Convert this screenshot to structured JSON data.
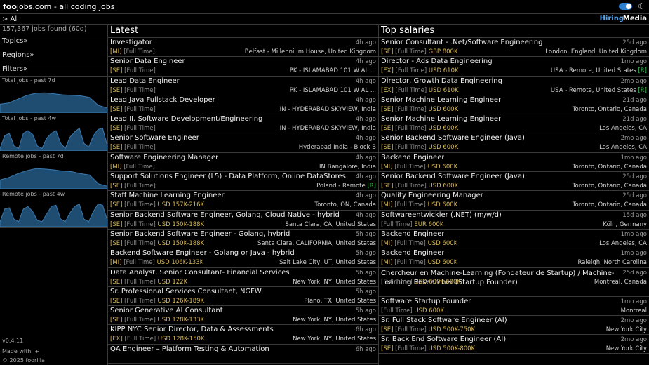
{
  "header": {
    "logo_bold": "foo",
    "logo_rest": "jobs.com - all coding jobs"
  },
  "nav": {
    "breadcrumb": "> All",
    "hiring_label": "Hiring",
    "media_label": "Media"
  },
  "sidebar": {
    "jobs_found": "157,367 jobs found (60d)",
    "menus": [
      "Topics»",
      "Regions»",
      "Filters»"
    ],
    "charts": [
      {
        "title": "Total jobs - past 7d",
        "values": [
          0.35,
          0.4,
          0.55,
          0.7,
          0.78,
          0.8,
          0.76,
          0.72,
          0.7,
          0.68,
          0.62,
          0.3,
          0.2
        ]
      },
      {
        "title": "Total jobs - past 4w",
        "values": [
          0.1,
          0.6,
          0.7,
          0.2,
          0.1,
          0.7,
          0.8,
          0.65,
          0.2,
          0.1,
          0.5,
          0.7,
          0.8,
          0.3,
          0.1,
          0.55,
          0.75,
          0.9,
          0.3,
          0.15,
          0.6,
          0.85,
          0.9,
          0.2
        ]
      },
      {
        "title": "Remote jobs - past 7d",
        "values": [
          0.35,
          0.45,
          0.6,
          0.72,
          0.8,
          0.78,
          0.75,
          0.7,
          0.68,
          0.6,
          0.55,
          0.2,
          0.1
        ]
      },
      {
        "title": "Remote jobs - past 4w",
        "values": [
          0.2,
          0.7,
          0.75,
          0.3,
          0.2,
          0.7,
          0.8,
          0.6,
          0.25,
          0.2,
          0.5,
          0.8,
          0.85,
          0.3,
          0.2,
          0.55,
          0.8,
          0.9,
          0.3,
          0.2,
          0.6,
          0.9,
          0.85,
          0.25
        ]
      }
    ],
    "version": "v0.4.11",
    "made_with": "Made with",
    "heart": "+",
    "copyright": "© 2025 foorilla"
  },
  "latest": {
    "heading": "Latest",
    "jobs": [
      {
        "title": "Investigator",
        "age": "4h ago",
        "level": "[MI]",
        "type": "[Full Time]",
        "salary": "",
        "location": "Belfast - Millennium House, United Kingdom",
        "remote": ""
      },
      {
        "title": "Senior Data Engineer",
        "age": "4h ago",
        "level": "[SE]",
        "type": "[Full Time]",
        "salary": "",
        "location": "PK - ISLAMABAD 101 W AL ...",
        "remote": ""
      },
      {
        "title": "Lead Data Engineer",
        "age": "4h ago",
        "level": "[SE]",
        "type": "[Full Time]",
        "salary": "",
        "location": "PK - ISLAMABAD 101 W AL ...",
        "remote": ""
      },
      {
        "title": "Lead Java Fullstack Developer",
        "age": "4h ago",
        "level": "[SE]",
        "type": "[Full Time]",
        "salary": "",
        "location": "IN - HYDERABAD SKYVIEW, India",
        "remote": ""
      },
      {
        "title": "Lead II, Software Development/Engineering",
        "age": "4h ago",
        "level": "[SE]",
        "type": "[Full Time]",
        "salary": "",
        "location": "IN - HYDERABAD SKYVIEW, India",
        "remote": ""
      },
      {
        "title": "Senior Software Engineer",
        "age": "4h ago",
        "level": "[SE]",
        "type": "[Full Time]",
        "salary": "",
        "location": "Hyderabad India - Block B",
        "remote": ""
      },
      {
        "title": "Software Engineering Manager",
        "age": "4h ago",
        "level": "[MI]",
        "type": "[Full Time]",
        "salary": "",
        "location": "IN Bangalore, India",
        "remote": ""
      },
      {
        "title": "Support Solutions Engineer (L5) - Data Platform, Online DataStores",
        "age": "4h ago",
        "level": "[SE]",
        "type": "[Full Time]",
        "salary": "",
        "location": "Poland - Remote",
        "remote": "[R]"
      },
      {
        "title": "Staff Machine Learning Engineer",
        "age": "4h ago",
        "level": "[SE]",
        "type": "[Full Time]",
        "salary": "USD 157K-216K",
        "location": "Toronto, ON, Canada",
        "remote": ""
      },
      {
        "title": "Senior Backend Software Engineer, Golang, Cloud Native - hybrid",
        "age": "4h ago",
        "level": "[SE]",
        "type": "[Full Time]",
        "salary": "USD 150K-188K",
        "location": "Santa Clara, CA, United States",
        "remote": ""
      },
      {
        "title": "Senior Backend Software Engineer - Golang, hybrid",
        "age": "5h ago",
        "level": "[SE]",
        "type": "[Full Time]",
        "salary": "USD 150K-188K",
        "location": "Santa Clara, CALIFORNIA, United States",
        "remote": ""
      },
      {
        "title": "Backend Software Engineer - Golang or Java - hybrid",
        "age": "5h ago",
        "level": "[MI]",
        "type": "[Full Time]",
        "salary": "USD 106K-133K",
        "location": "Salt Lake City, UT, United States",
        "remote": ""
      },
      {
        "title": "Data Analyst, Senior Consultant- Financial Services",
        "age": "5h ago",
        "level": "[SE]",
        "type": "[Full Time]",
        "salary": "USD 122K",
        "location": "New York, NY, United States",
        "remote": ""
      },
      {
        "title": "Sr. Professional Services Consultant, NGFW",
        "age": "5h ago",
        "level": "[SE]",
        "type": "[Full Time]",
        "salary": "USD 126K-189K",
        "location": "Plano, TX, United States",
        "remote": ""
      },
      {
        "title": "Senior Generative AI Consultant",
        "age": "5h ago",
        "level": "[SE]",
        "type": "[Full Time]",
        "salary": "USD 128K-133K",
        "location": "New York, NY, United States",
        "remote": ""
      },
      {
        "title": "KIPP NYC Senior Director, Data & Assessments",
        "age": "6h ago",
        "level": "[EX]",
        "type": "[Full Time]",
        "salary": "USD 128K-150K",
        "location": "New York, NY, United States",
        "remote": ""
      },
      {
        "title": "QA Engineer – Platform Testing & Automation",
        "age": "6h ago",
        "level": "",
        "type": "",
        "salary": "",
        "location": "",
        "remote": ""
      }
    ]
  },
  "top": {
    "heading": "Top salaries",
    "jobs": [
      {
        "title": "Senior Consultant - .Net/Software Engineering",
        "age": "25d ago",
        "level": "[SE]",
        "type": "[Full Time]",
        "salary": "GBP 800K",
        "location": "London, England, United Kingdom",
        "remote": ""
      },
      {
        "title": "Director - Ads Data Engineering",
        "age": "1mo ago",
        "level": "[EX]",
        "type": "[Full Time]",
        "salary": "USD 610K",
        "location": "USA - Remote, United States",
        "remote": "[R]"
      },
      {
        "title": "Director, Growth Data Engineering",
        "age": "2mo ago",
        "level": "[EX]",
        "type": "[Full Time]",
        "salary": "USD 610K",
        "location": "USA - Remote, United States",
        "remote": "[R]"
      },
      {
        "title": "Senior Machine Learning Engineer",
        "age": "21d ago",
        "level": "[SE]",
        "type": "[Full Time]",
        "salary": "USD 600K",
        "location": "Toronto, Ontario, Canada",
        "remote": ""
      },
      {
        "title": "Senior Machine Learning Engineer",
        "age": "21d ago",
        "level": "[SE]",
        "type": "[Full Time]",
        "salary": "USD 600K",
        "location": "Los Angeles, CA",
        "remote": ""
      },
      {
        "title": "Senior Backend Software Engineer (Java)",
        "age": "2mo ago",
        "level": "[SE]",
        "type": "[Full Time]",
        "salary": "USD 600K",
        "location": "Los Angeles, CA",
        "remote": ""
      },
      {
        "title": "Backend Engineer",
        "age": "1mo ago",
        "level": "[MI]",
        "type": "[Full Time]",
        "salary": "USD 600K",
        "location": "Toronto, Ontario, Canada",
        "remote": ""
      },
      {
        "title": "Senior Backend Software Engineer (Java)",
        "age": "25d ago",
        "level": "[SE]",
        "type": "[Full Time]",
        "salary": "USD 600K",
        "location": "Toronto, Ontario, Canada",
        "remote": ""
      },
      {
        "title": "Quality Engineering Manager",
        "age": "25d ago",
        "level": "[MI]",
        "type": "[Full Time]",
        "salary": "USD 600K",
        "location": "Toronto, Ontario, Canada",
        "remote": ""
      },
      {
        "title": "Softwareentwickler (.NET) (m/w/d)",
        "age": "15d ago",
        "level": "",
        "type": "[Full Time]",
        "salary": "EUR 600K",
        "location": "Köln, Germany",
        "remote": ""
      },
      {
        "title": "Backend Engineer",
        "age": "1mo ago",
        "level": "[MI]",
        "type": "[Full Time]",
        "salary": "USD 600K",
        "location": "Los Angeles, CA",
        "remote": ""
      },
      {
        "title": "Backend Engineer",
        "age": "1mo ago",
        "level": "[MI]",
        "type": "[Full Time]",
        "salary": "USD 600K",
        "location": "Raleigh, North Carolina",
        "remote": ""
      },
      {
        "title": "Chercheur en Machine-Learning (Fondateur de Startup) / Machine-Learning Researcher (Startup Founder)",
        "age": "25d ago",
        "level": "",
        "type": "[Full Time]",
        "salary": "USD 600K-600K",
        "location": "Montreal, Canada",
        "remote": "",
        "tall": true
      },
      {
        "title": "Software Startup Founder",
        "age": "1mo ago",
        "level": "",
        "type": "[Full Time]",
        "salary": "USD 600K",
        "location": "Montreal",
        "remote": ""
      },
      {
        "title": "Sr. Full Stack Software Engineer (AI)",
        "age": "2mo ago",
        "level": "[SE]",
        "type": "[Full Time]",
        "salary": "USD 500K-750K",
        "location": "New York City",
        "remote": ""
      },
      {
        "title": "Sr. Back End Software Engineer (AI)",
        "age": "2mo ago",
        "level": "[SE]",
        "type": "[Full Time]",
        "salary": "USD 500K-800K",
        "location": "New York City",
        "remote": ""
      }
    ]
  }
}
